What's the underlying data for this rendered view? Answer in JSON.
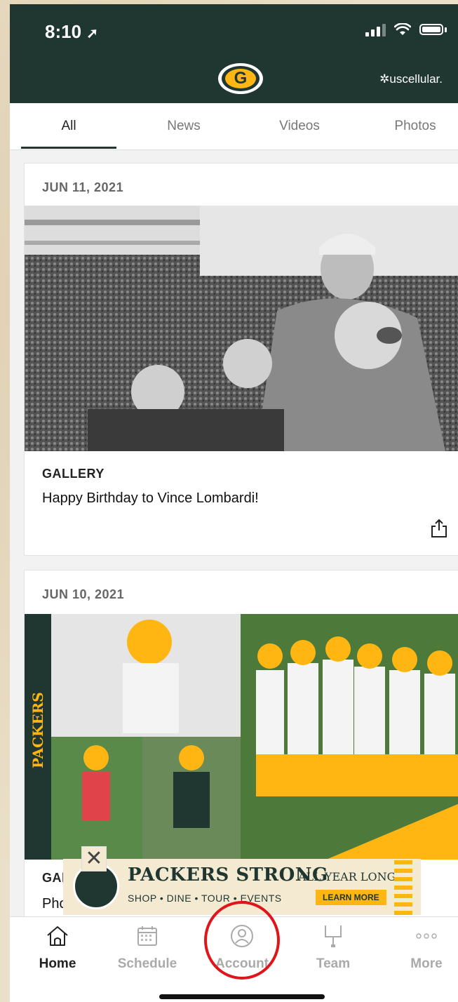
{
  "status_bar": {
    "time": "8:10"
  },
  "header": {
    "logo_letter": "G",
    "sponsor": "✲uscellular."
  },
  "tabs": [
    {
      "label": "All",
      "active": true
    },
    {
      "label": "News",
      "active": false
    },
    {
      "label": "Videos",
      "active": false
    },
    {
      "label": "Photos",
      "active": false
    }
  ],
  "cards": [
    {
      "date": "JUN 11, 2021",
      "category": "GALLERY",
      "title": "Happy Birthday to Vince Lombardi!",
      "share_icon": "share-icon"
    },
    {
      "date": "JUN 10, 2021",
      "category": "GAl",
      "title": "Pho",
      "side_label": "PACKERS"
    }
  ],
  "ad": {
    "close": "✕",
    "headline": "PACKERS STRONG",
    "suffix": "ALL YEAR LONG",
    "tagline": "SHOP • DINE • TOUR • EVENTS",
    "cta": "LEARN MORE"
  },
  "bottom_nav": [
    {
      "label": "Home",
      "icon": "home-icon",
      "active": true
    },
    {
      "label": "Schedule",
      "icon": "calendar-icon",
      "active": false
    },
    {
      "label": "Account",
      "icon": "user-icon",
      "active": false
    },
    {
      "label": "Team",
      "icon": "goalpost-icon",
      "active": false
    },
    {
      "label": "More",
      "icon": "more-icon",
      "active": false
    }
  ],
  "colors": {
    "brand_green": "#203731",
    "brand_gold": "#ffb612",
    "annotation_red": "#e0141b"
  }
}
